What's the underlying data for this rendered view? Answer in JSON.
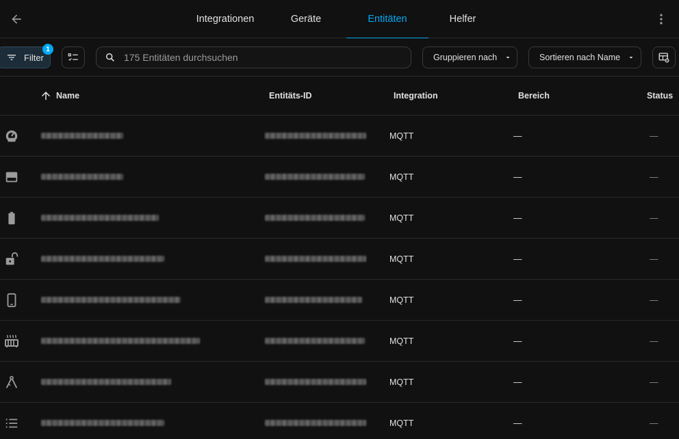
{
  "header": {
    "tabs": [
      {
        "label": "Integrationen"
      },
      {
        "label": "Geräte"
      },
      {
        "label": "Entitäten"
      },
      {
        "label": "Helfer"
      }
    ],
    "active_tab": "Entitäten"
  },
  "toolbar": {
    "filter_label": "Filter",
    "filter_badge": "1",
    "search_placeholder": "175 Entitäten durchsuchen",
    "group_label": "Gruppieren nach",
    "sort_label": "Sortieren nach Name"
  },
  "table": {
    "columns": {
      "name": "Name",
      "entity_id": "Entitäts-ID",
      "integration": "Integration",
      "area": "Bereich",
      "status": "Status"
    },
    "rows": [
      {
        "icon": "gauge-icon",
        "integration": "MQTT",
        "area": "—",
        "status": "—"
      },
      {
        "icon": "card-icon",
        "integration": "MQTT",
        "area": "—",
        "status": "—"
      },
      {
        "icon": "battery-icon",
        "integration": "MQTT",
        "area": "—",
        "status": "—"
      },
      {
        "icon": "lock-open-icon",
        "integration": "MQTT",
        "area": "—",
        "status": "—"
      },
      {
        "icon": "phone-icon",
        "integration": "MQTT",
        "area": "—",
        "status": "—"
      },
      {
        "icon": "radiator-icon",
        "integration": "MQTT",
        "area": "—",
        "status": "—"
      },
      {
        "icon": "compass-icon",
        "integration": "MQTT",
        "area": "—",
        "status": "—"
      },
      {
        "icon": "list-icon",
        "integration": "MQTT",
        "area": "—",
        "status": "—"
      }
    ]
  },
  "colors": {
    "accent": "#03a9f4",
    "background": "#111111",
    "text": "#e1e1e1"
  }
}
